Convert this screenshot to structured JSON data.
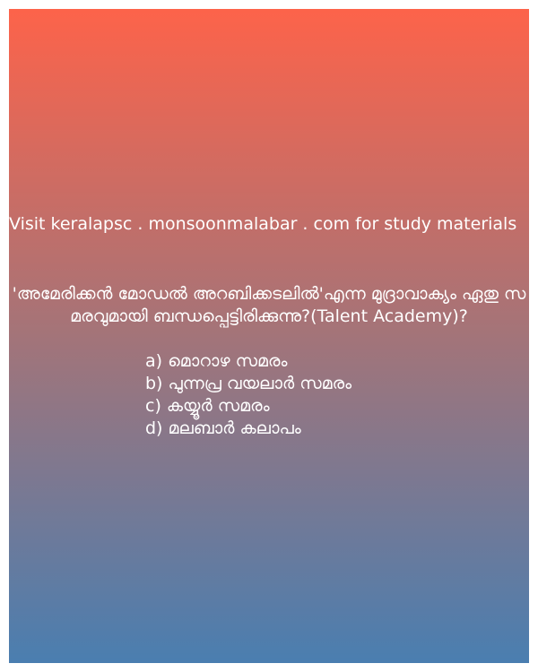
{
  "background": {
    "gradient_top": "#fd634a",
    "gradient_bottom": "#4a7eb0"
  },
  "site_line": "Visit keralapsc . monsoonmalabar . com for study materials",
  "question": {
    "text": " 'അമേരിക്കൻ മോഡൽ അറബിക്കടലിൽ'എന്ന മുദ്രാവാക്യം ഏതു സമരവുമായി ബന്ധപ്പെട്ടിരിക്കുന്നു?(Talent Academy)?",
    "options": [
      "a) മൊറാഴ സമരം",
      "b) പുന്നപ്ര വയലാർ സമരം",
      "c) കയ്യൂർ സമരം",
      "d) മലബാർ കലാപം"
    ]
  }
}
